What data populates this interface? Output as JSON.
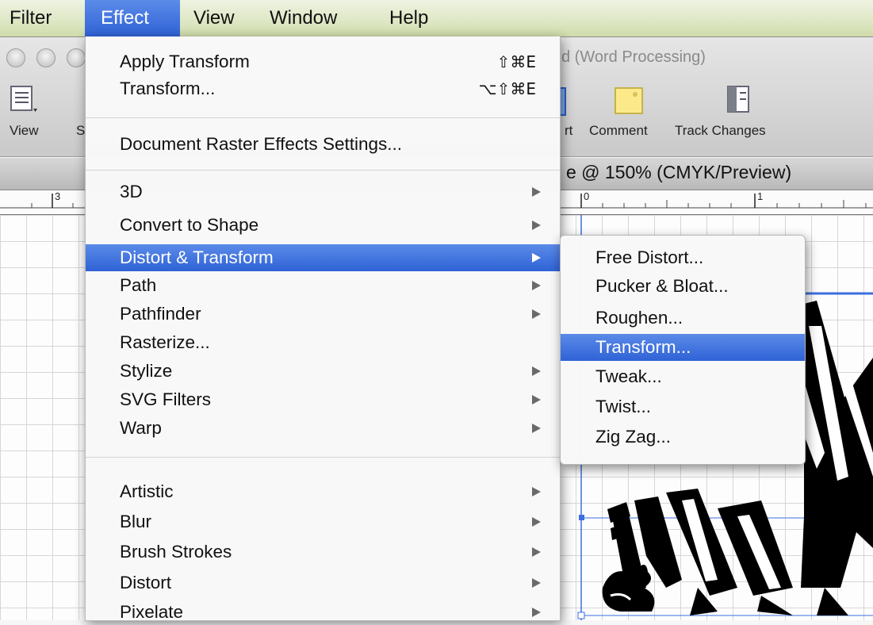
{
  "menubar": {
    "items": [
      "Filter",
      "Effect",
      "View",
      "Window",
      "Help"
    ],
    "active": "Effect"
  },
  "window": {
    "title": "d (Word Processing)",
    "toolbar_labels": [
      "View",
      "S",
      "rt",
      "Comment",
      "Track Changes"
    ],
    "doc_tab_title": "e @ 150% (CMYK/Preview)",
    "ruler_numbers": [
      "3",
      "0",
      "1"
    ]
  },
  "effect_menu": {
    "items": [
      {
        "label": "Apply Transform",
        "shortcut": "⇧⌘E"
      },
      {
        "label": "Transform...",
        "shortcut": "⌥⇧⌘E"
      },
      {
        "label": "Document Raster Effects Settings..."
      },
      {
        "label": "3D"
      },
      {
        "label": "Convert to Shape"
      },
      {
        "label": "Distort & Transform"
      },
      {
        "label": "Path"
      },
      {
        "label": "Pathfinder"
      },
      {
        "label": "Rasterize..."
      },
      {
        "label": "Stylize"
      },
      {
        "label": "SVG Filters"
      },
      {
        "label": "Warp"
      },
      {
        "label": "Artistic"
      },
      {
        "label": "Blur"
      },
      {
        "label": "Brush Strokes"
      },
      {
        "label": "Distort"
      },
      {
        "label": "Pixelate"
      }
    ],
    "highlighted": "Distort & Transform"
  },
  "submenu": {
    "items": [
      "Free Distort...",
      "Pucker & Bloat...",
      "Roughen...",
      "Transform...",
      "Tweak...",
      "Twist...",
      "Zig Zag..."
    ],
    "highlighted": "Transform..."
  },
  "colors": {
    "highlight": "#3a6fe0",
    "menubar_bg": "#dfe8c6"
  }
}
